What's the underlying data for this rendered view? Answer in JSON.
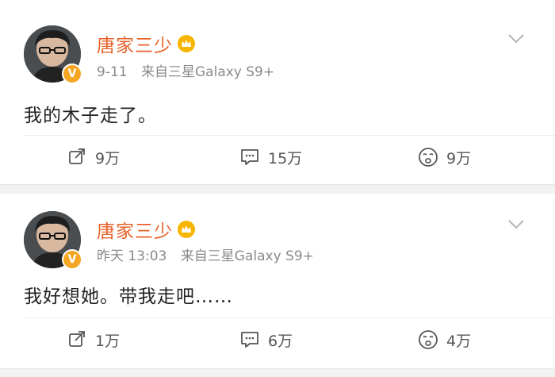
{
  "posts": [
    {
      "username": "唐家三少",
      "time": "9-11",
      "source": "来自三星Galaxy S9+",
      "content": "我的木子走了。",
      "shares": "9万",
      "comments": "15万",
      "likes": "9万"
    },
    {
      "username": "唐家三少",
      "time": "昨天 13:03",
      "source": "来自三星Galaxy S9+",
      "content": "我好想她。带我走吧……",
      "shares": "1万",
      "comments": "6万",
      "likes": "4万"
    }
  ],
  "icons": {
    "share": "share-icon",
    "comment": "comment-icon",
    "like": "sad-face-icon",
    "verified": "verified-v-icon",
    "member": "crown-icon",
    "more": "chevron-down-icon"
  },
  "colors": {
    "username": "#e8622a",
    "verified": "#f5a623",
    "meta": "#8a8a8a"
  }
}
